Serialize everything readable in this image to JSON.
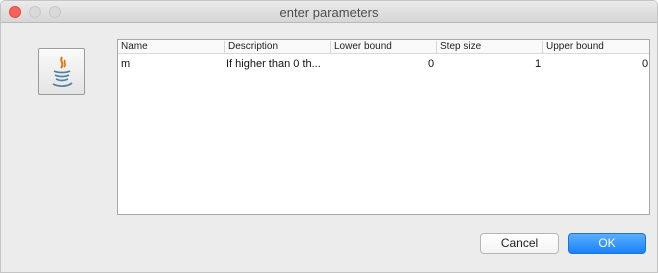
{
  "window": {
    "title": "enter parameters"
  },
  "icons": {
    "app": "java-cup-icon"
  },
  "table": {
    "columns": [
      "Name",
      "Description",
      "Lower bound",
      "Step size",
      "Upper bound"
    ],
    "rows": [
      [
        "m",
        "If higher than 0 th...",
        "0",
        "1",
        "0"
      ]
    ]
  },
  "buttons": {
    "cancel": "Cancel",
    "ok": "OK"
  },
  "colors": {
    "close": "#fc605c",
    "ok_button": "#1a82fb"
  }
}
